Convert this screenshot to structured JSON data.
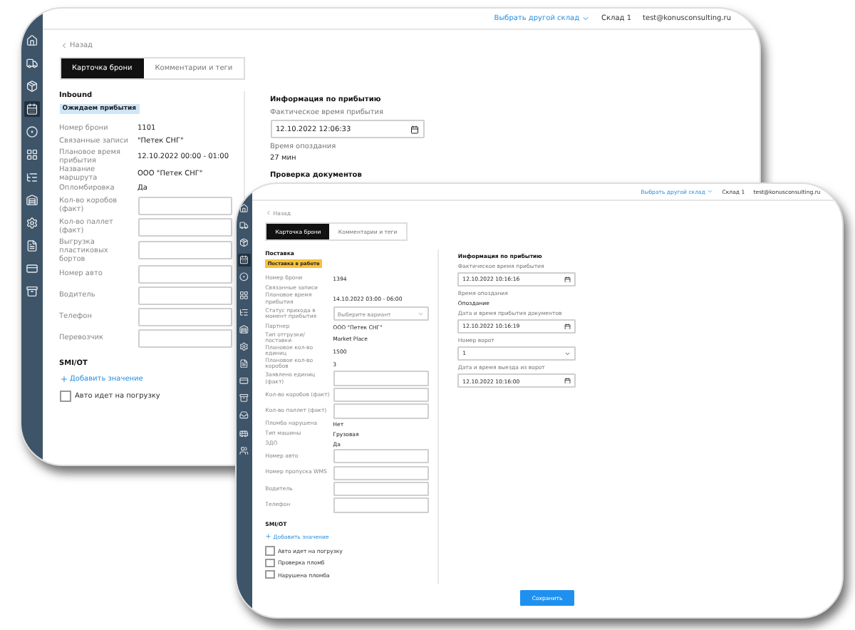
{
  "windows": [
    {
      "header": {
        "warehouse_link": "Выбрать другой склад",
        "warehouse": "Склад 1",
        "email": "test@konusconsulting.ru"
      },
      "sidebar": [
        {
          "selected": false
        },
        {
          "selected": false
        },
        {
          "selected": false
        },
        {
          "selected": true
        },
        {
          "selected": false
        },
        {
          "selected": false
        },
        {
          "selected": false
        },
        {
          "selected": false
        },
        {
          "selected": false
        },
        {
          "selected": false
        },
        {
          "selected": false
        },
        {
          "selected": false
        }
      ],
      "back": "Назад",
      "tabs": [
        {
          "label": "Карточка брони",
          "selected": true
        },
        {
          "label": "Комментарии и теги",
          "selected": false
        }
      ],
      "section_title": "Inbound",
      "badge": {
        "text": "Ожидаем прибытия",
        "kind": "info"
      },
      "rows": [
        {
          "kind": "info",
          "label": "Номер брони",
          "value": "1101"
        },
        {
          "kind": "info",
          "label": "Связанные записи",
          "value": "\"Петек СНГ\""
        },
        {
          "kind": "info",
          "label": "Плановое время прибытия",
          "value": "12.10.2022 00:00 - 01:00"
        },
        {
          "kind": "info",
          "label": "Название маршрута",
          "value": "ООО \"Петек СНГ\""
        },
        {
          "kind": "info",
          "label": "Опломбировка",
          "value": "Да"
        },
        {
          "kind": "input",
          "label": "Кол-во коробов (факт)"
        },
        {
          "kind": "input",
          "label": "Кол-во паллет (факт)"
        },
        {
          "kind": "input",
          "label": "Выгрузка пластиковых бортов"
        },
        {
          "kind": "input",
          "label": "Номер авто"
        },
        {
          "kind": "input",
          "label": "Водитель"
        },
        {
          "kind": "input",
          "label": "Телефон"
        },
        {
          "kind": "input",
          "label": "Перевозчик"
        }
      ],
      "extra_title": "SMI/OT",
      "add_link": "Добавить значение",
      "checkboxes": [
        {
          "label": "Авто идет на погрузку",
          "checked": false
        }
      ],
      "right": [
        {
          "kind": "heading",
          "text": "Информация по прибытию"
        },
        {
          "kind": "date",
          "label": "Фактическое время прибытия",
          "value": "12.10.2022 12:06:33"
        },
        {
          "kind": "info",
          "label": "Время опоздания",
          "value": "27 мин"
        },
        {
          "kind": "heading",
          "text": "Проверка документов"
        }
      ]
    },
    {
      "header": {
        "warehouse_link": "Выбрать другой склад",
        "warehouse": "Склад 1",
        "email": "test@konusconsulting.ru"
      },
      "sidebar": [
        {
          "selected": false
        },
        {
          "selected": false
        },
        {
          "selected": false
        },
        {
          "selected": true
        },
        {
          "selected": false
        },
        {
          "selected": false
        },
        {
          "selected": false
        },
        {
          "selected": false
        },
        {
          "selected": false
        },
        {
          "selected": false
        },
        {
          "selected": false
        },
        {
          "selected": false
        },
        {
          "selected": false
        },
        {
          "selected": false
        },
        {
          "selected": false
        }
      ],
      "back": "Назад",
      "tabs": [
        {
          "label": "Карточка брони",
          "selected": true
        },
        {
          "label": "Комментарии и теги",
          "selected": false
        }
      ],
      "section_title": "Поставка",
      "badge": {
        "text": "Поставка в работе",
        "kind": "warning"
      },
      "rows": [
        {
          "kind": "info",
          "label": "Номер брони",
          "value": "1394"
        },
        {
          "kind": "info",
          "label": "Связанные записи"
        },
        {
          "kind": "info",
          "label": "Плановое время прибытия",
          "value": "14.10.2022 03:00 - 06:00"
        },
        {
          "kind": "select",
          "label": "Статус прихода в момент прибытия",
          "placeholder": "Выберите вариант"
        },
        {
          "kind": "info",
          "label": "Партнер",
          "value": "ООО \"Петек СНГ\""
        },
        {
          "kind": "info",
          "label": "Тип отгрузки/поставки",
          "value": "Market Place"
        },
        {
          "kind": "info",
          "label": "Плановое кол-во единиц",
          "value": "1500"
        },
        {
          "kind": "info",
          "label": "Плановое кол-во коробов",
          "value": "3"
        },
        {
          "kind": "input",
          "label": "Заявлено единиц (факт)"
        },
        {
          "kind": "input",
          "label": "Кол-во коробов (факт)"
        },
        {
          "kind": "input",
          "label": "Кол-во паллет (факт)"
        },
        {
          "kind": "info",
          "label": "Пломба нарушена",
          "value": "Нет"
        },
        {
          "kind": "info",
          "label": "Тип машины",
          "value": "Грузовая"
        },
        {
          "kind": "info",
          "label": "ЭДО",
          "value": "Да"
        },
        {
          "kind": "input",
          "label": "Номер авто"
        },
        {
          "kind": "input",
          "label": "Номер пропуска WMS"
        },
        {
          "kind": "input",
          "label": "Водитель"
        },
        {
          "kind": "input",
          "label": "Телефон"
        }
      ],
      "extra_title": "SMI/OT",
      "add_link": "Добавить значение",
      "checkboxes": [
        {
          "label": "Авто идет на погрузку",
          "checked": false
        },
        {
          "label": "Проверка пломб",
          "checked": false
        },
        {
          "label": "Нарушена пломба",
          "checked": false
        }
      ],
      "right": [
        {
          "kind": "heading",
          "text": "Информация по прибытию"
        },
        {
          "kind": "date",
          "label": "Фактическое время прибытия",
          "value": "12.10.2022 10:16:16"
        },
        {
          "kind": "info",
          "label": "Время опоздания",
          "value": "Опоздание"
        },
        {
          "kind": "date",
          "label": "Дата и время прибытия документов",
          "value": "12.10.2022 10:16:19"
        },
        {
          "kind": "select",
          "label": "Номер ворот",
          "placeholder": "1"
        },
        {
          "kind": "date",
          "label": "Дата и время выезда из ворот",
          "value": "12.10.2022 10:16:00"
        }
      ],
      "save_button": "Сохранить"
    }
  ]
}
